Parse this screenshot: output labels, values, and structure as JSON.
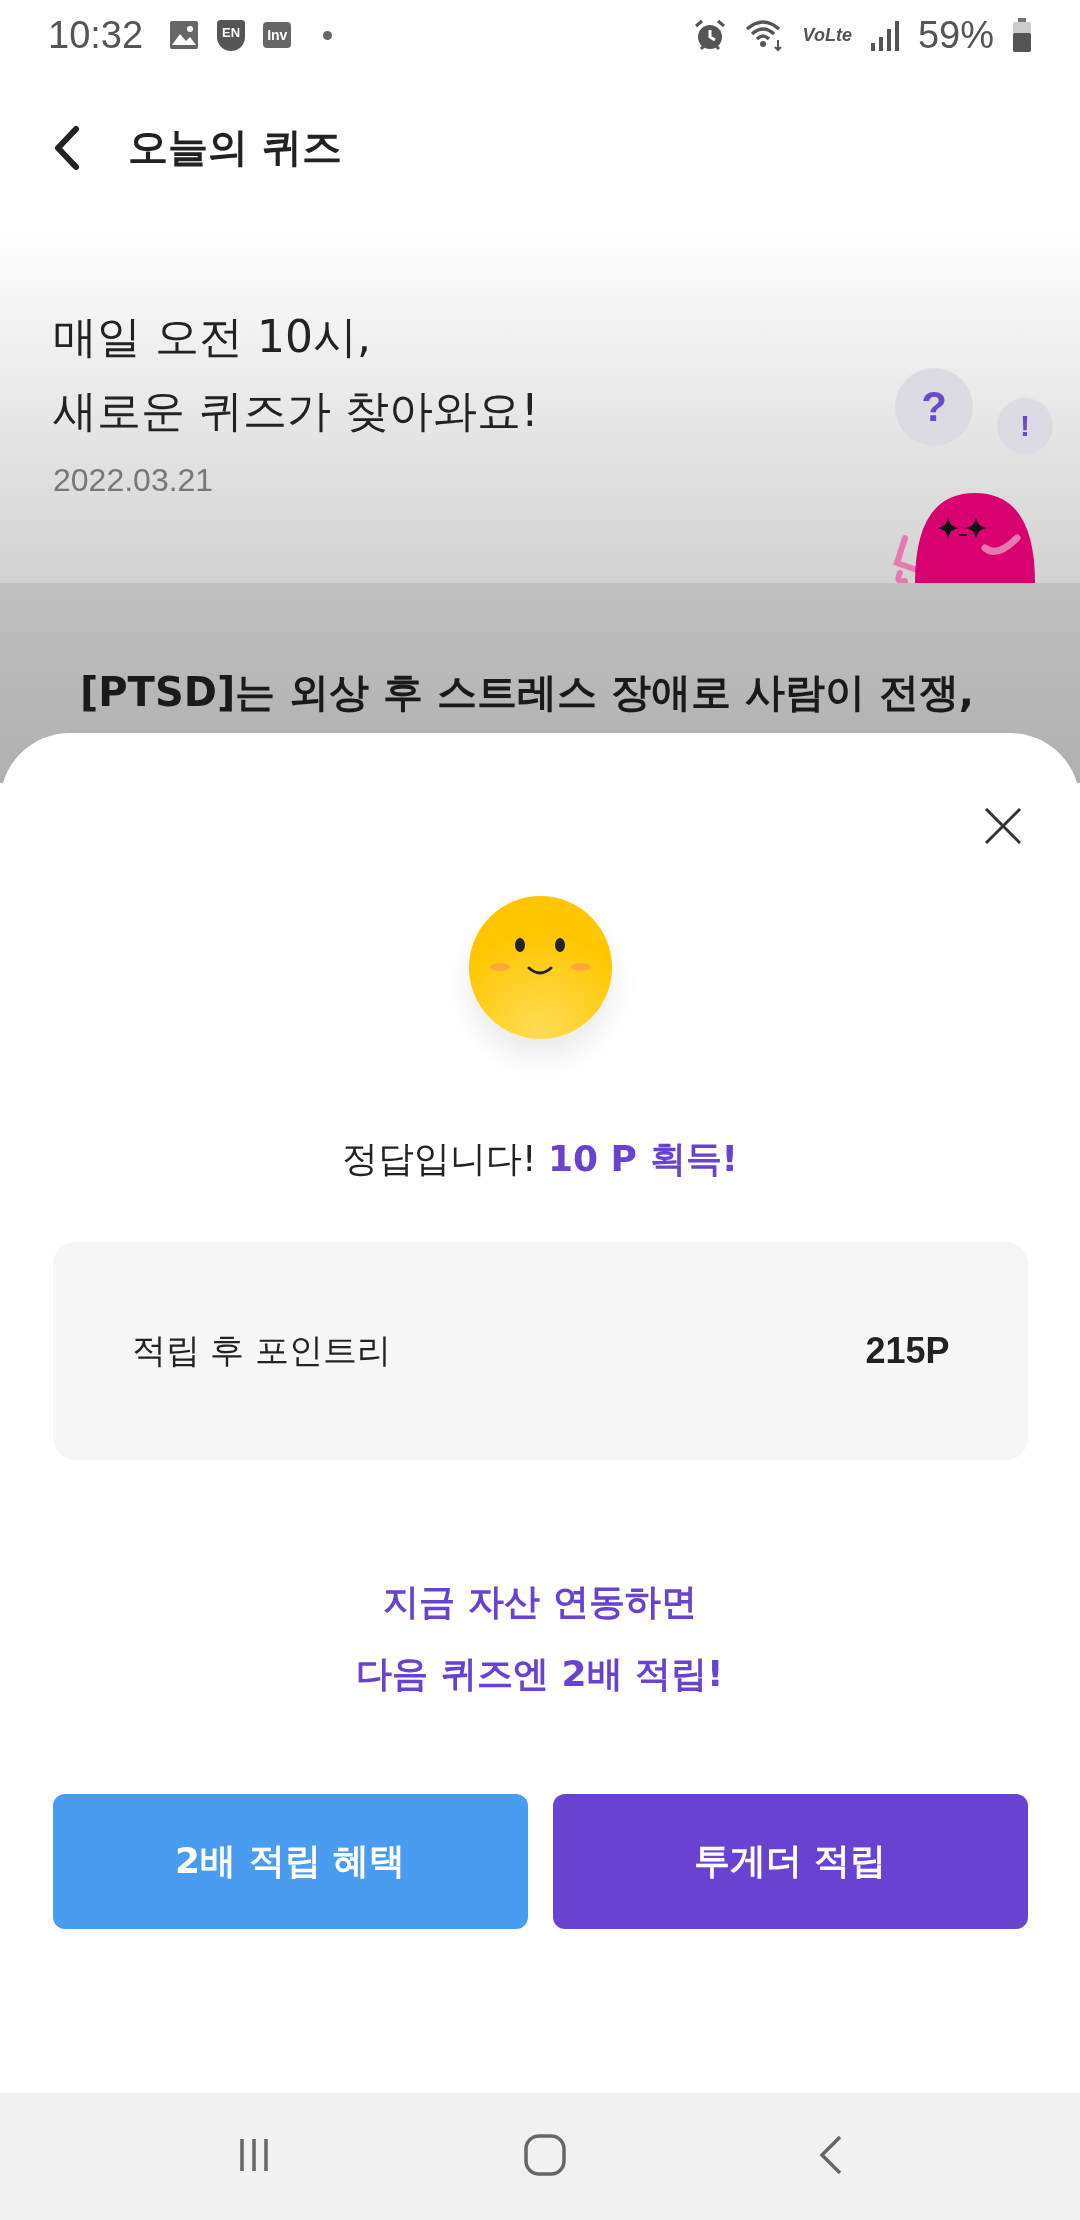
{
  "status_bar": {
    "time": "10:32",
    "badges": [
      "EN",
      "Inv"
    ],
    "network_label": "VoLte",
    "battery": "59%"
  },
  "header": {
    "title": "오늘의 퀴즈"
  },
  "hero": {
    "lines": [
      "매일 오전 10시,",
      "새로운 퀴즈가 찾아와요!"
    ],
    "date": "2022.03.21",
    "bubbles": [
      "?",
      "!"
    ]
  },
  "question_preview": "[PTSD]는 외상 후 스트레스 장애로 사람이 전쟁,",
  "sheet": {
    "result": "정답입니다! **10 P 획득!**",
    "points": {
      "label": "적립 후 포인트리",
      "value": "215P"
    },
    "promo": [
      "지금 자산 연동하면",
      "다음 퀴즈엔 2배 적립!"
    ],
    "buttons": [
      {
        "label": "2배 적립 혜택",
        "kind": "secondary"
      },
      {
        "label": "투게더 적립",
        "kind": "primary"
      }
    ]
  }
}
